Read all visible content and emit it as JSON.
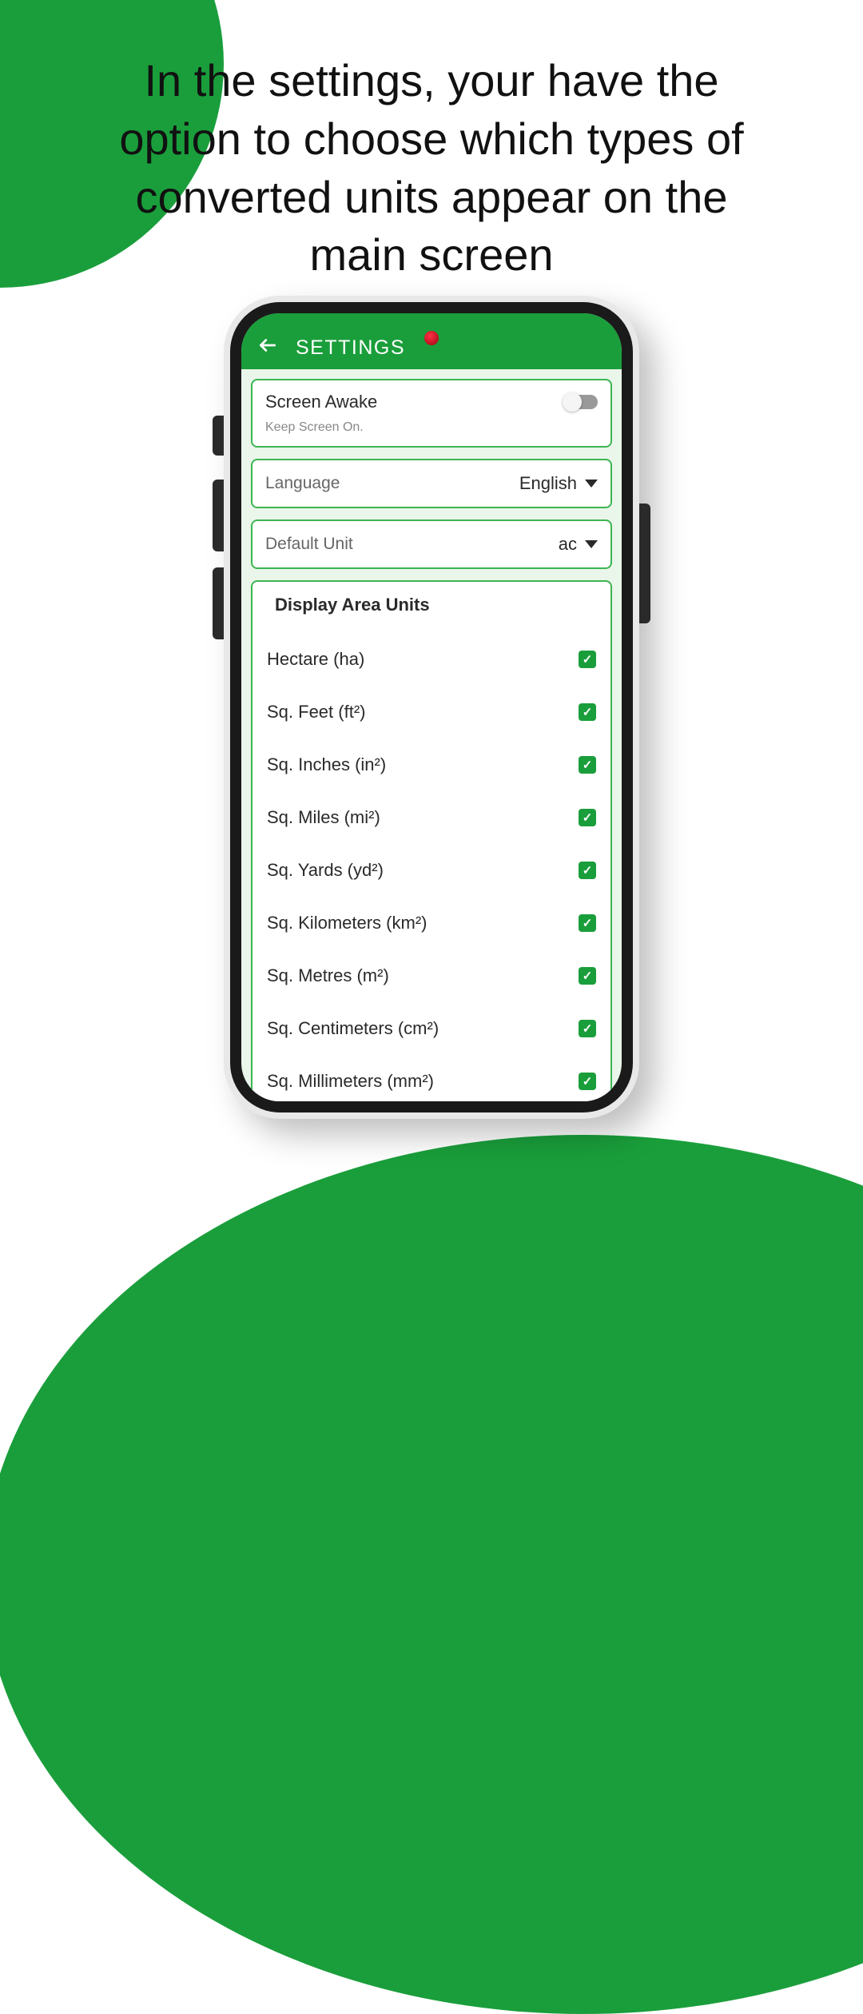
{
  "headline": "In the settings, your have the option to choose which types of converted units appear on the main screen",
  "appBar": {
    "title": "SETTINGS"
  },
  "screenAwake": {
    "title": "Screen Awake",
    "subtitle": "Keep Screen On.",
    "enabled": false
  },
  "language": {
    "label": "Language",
    "value": "English"
  },
  "defaultUnit": {
    "label": "Default Unit",
    "value": "ac"
  },
  "displayUnits": {
    "header": "Display Area Units",
    "items": [
      {
        "label": "Hectare (ha)",
        "checked": true
      },
      {
        "label": "Sq. Feet (ft²)",
        "checked": true
      },
      {
        "label": "Sq. Inches (in²)",
        "checked": true
      },
      {
        "label": "Sq. Miles (mi²)",
        "checked": true
      },
      {
        "label": "Sq. Yards (yd²)",
        "checked": true
      },
      {
        "label": "Sq. Kilometers (km²)",
        "checked": true
      },
      {
        "label": "Sq. Metres (m²)",
        "checked": true
      },
      {
        "label": "Sq. Centimeters (cm²)",
        "checked": true
      },
      {
        "label": "Sq. Millimeters (mm²)",
        "checked": true
      }
    ]
  }
}
